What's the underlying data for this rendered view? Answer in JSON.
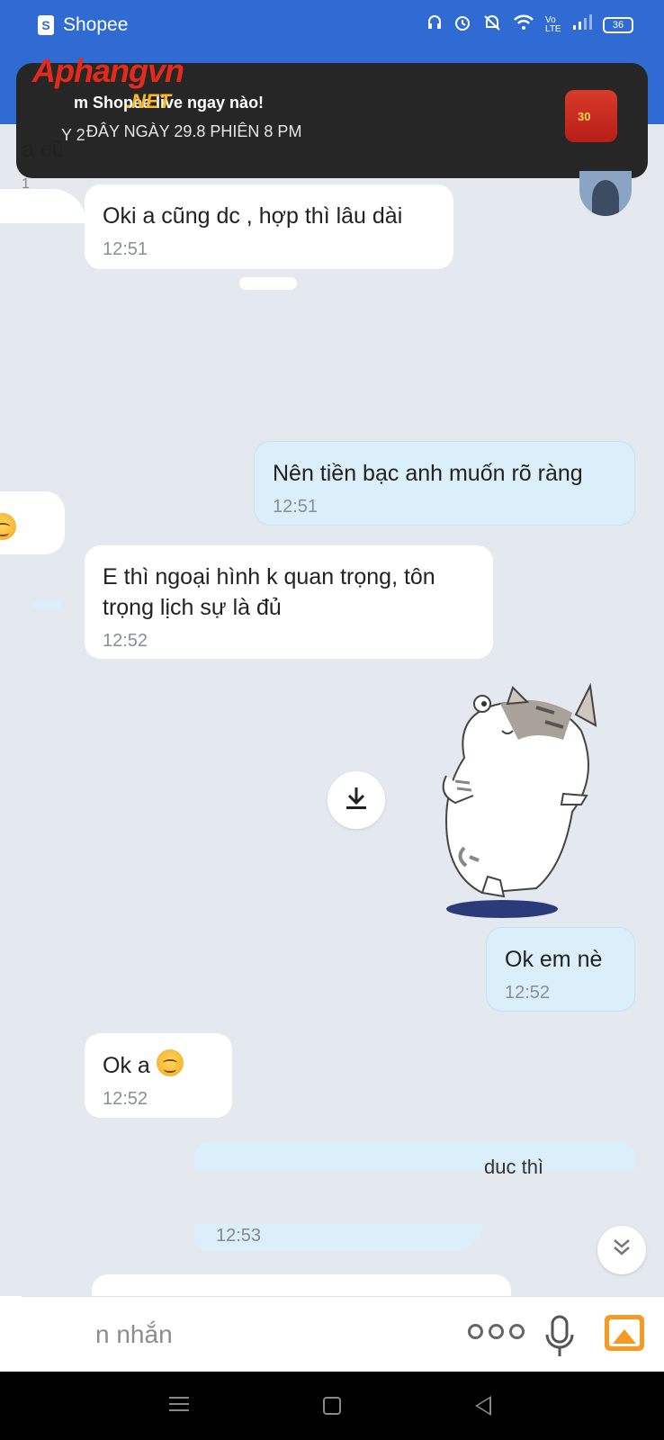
{
  "status_bar": {
    "app_name": "Shopee",
    "battery": "36",
    "network": "Vo LTE"
  },
  "notification": {
    "title": "m Shopee live ngay nào!",
    "body": "ĐÂY NGÀY 29.8 PHIÊN 8 PM",
    "body_prefix": "Y 2",
    "thumb_text": "30"
  },
  "watermark": {
    "brand": "Aphangvn",
    "suffix": ".NET"
  },
  "partial_scraps": {
    "left_text": "a cũ",
    "left_time": "1",
    "redacted_outgoing_text": "duc thì",
    "redacted_outgoing_time": "12:53",
    "redacted_input_text": "n nhắn"
  },
  "messages": [
    {
      "side": "incoming",
      "text": "Oki a cũng dc , hợp thì lâu dài",
      "time": "12:51"
    },
    {
      "side": "outgoing",
      "text": "Nên tiền bạc anh muốn rõ ràng",
      "time": "12:51"
    },
    {
      "side": "incoming",
      "text": "E thì ngoại hình k quan trọng, tôn trọng lịch sự là đủ",
      "time": "12:52"
    },
    {
      "side": "outgoing",
      "text": "Ok em nè",
      "time": "12:52"
    },
    {
      "side": "incoming",
      "text": "Ok a",
      "time": "12:52"
    }
  ],
  "colors": {
    "header_blue": "#2f6bd3",
    "chat_background": "#e4e8ef",
    "incoming_bubble": "#ffffff",
    "outgoing_bubble": "#dbeffb",
    "image_icon": "#f59a23"
  },
  "icons": {
    "download": "download-icon",
    "scroll_down": "double-chevron-down-icon",
    "more": "more-dots-icon",
    "mic": "microphone-icon",
    "image": "image-icon",
    "sticker": "cat-sticker"
  }
}
